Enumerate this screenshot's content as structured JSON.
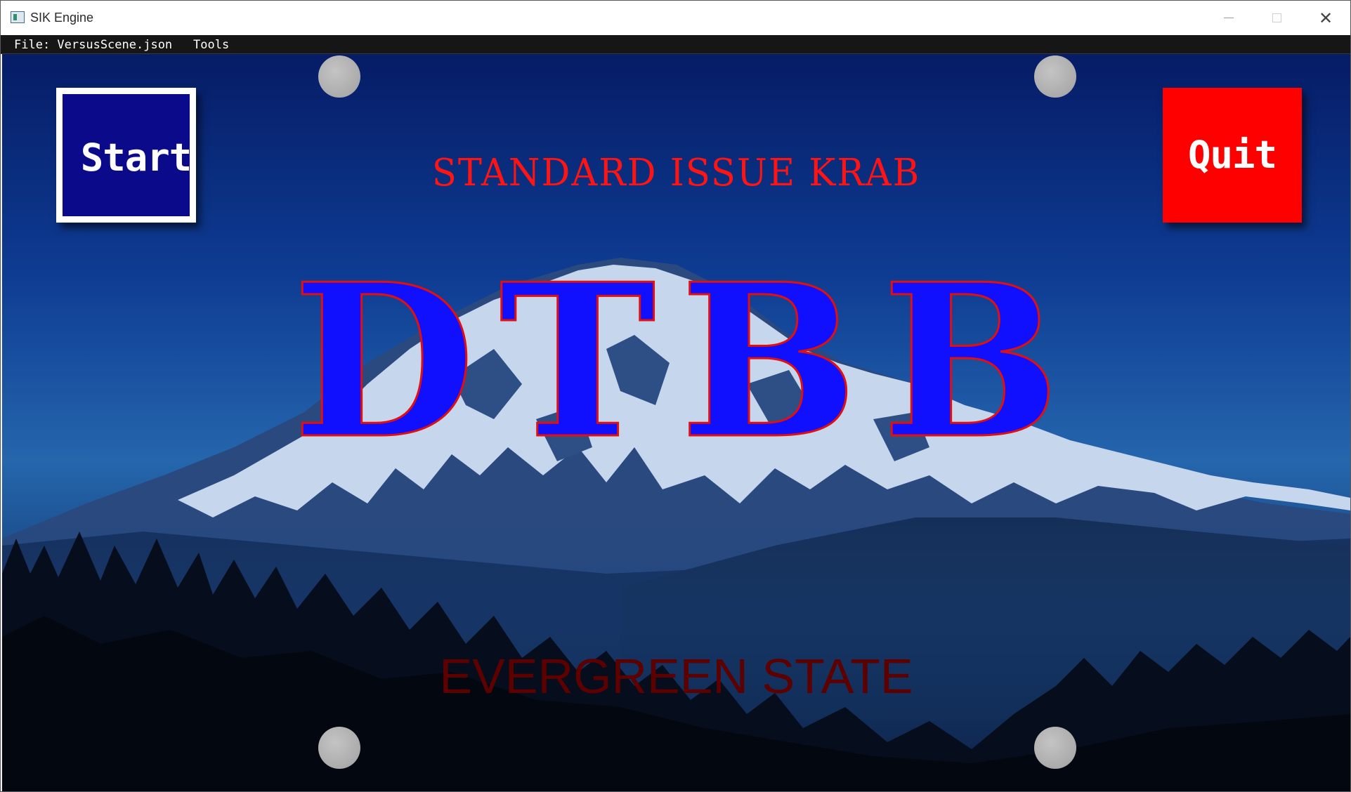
{
  "window": {
    "title": "SIK Engine"
  },
  "menubar": {
    "file_label": "File: VersusScene.json",
    "tools_label": "Tools"
  },
  "scene": {
    "start_label": "Start",
    "quit_label": "Quit",
    "subtitle": "STANDARD ISSUE KRAB",
    "plate_text": "DTBB",
    "state_text": "EVERGREEN STATE"
  },
  "colors": {
    "start_button_bg": "#0a0a8a",
    "quit_button_bg": "#ff0000",
    "subtitle": "#ff1414",
    "plate_fill": "#1010ff",
    "plate_outline": "#e01010",
    "state_text": "#5c0000",
    "bolt": "#ababab"
  },
  "icons": {
    "app": "app-window-icon",
    "minimize": "minimize-icon",
    "maximize": "maximize-icon",
    "close": "close-icon"
  }
}
